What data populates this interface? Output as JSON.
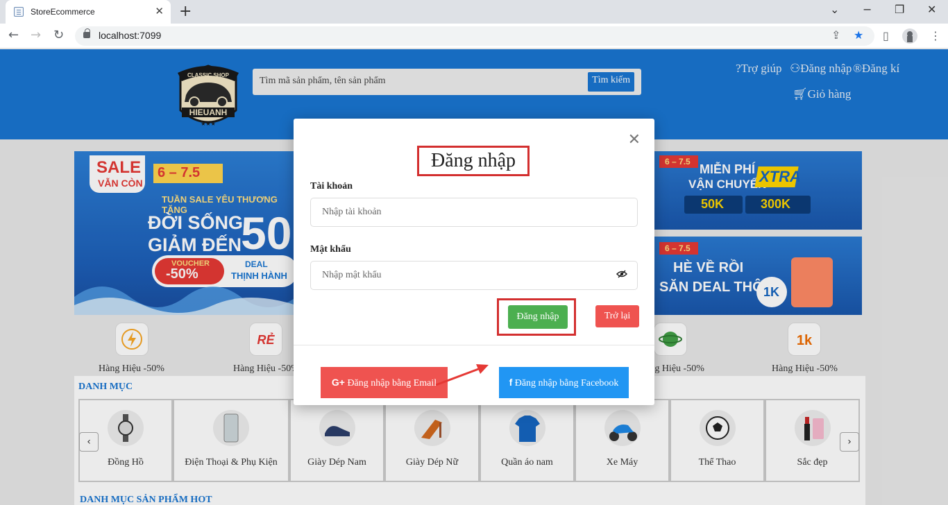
{
  "browser": {
    "tab_title": "StoreEcommerce",
    "url": "localhost:7099"
  },
  "header": {
    "search_placeholder": "Tìm mã sản phẩm, tên sản phẩm",
    "search_button": "Tìm kiếm",
    "help": "Trợ giúp",
    "login": "Đăng nhập",
    "register": "Đăng kí",
    "cart": "Giỏ hàng",
    "logo": {
      "top": "CLASSIC SHOP",
      "name": "HIEUANH"
    }
  },
  "banners": {
    "left": {
      "sale": "SALE",
      "sub": "VẪN CÒN",
      "dates": "6 – 7.5",
      "line1": "TUẦN SALE YÊU THƯƠNG TẶNG",
      "line2": "ĐỜI SỐNG",
      "line3": "GIẢM ĐẾN",
      "big": "50",
      "voucher": "VOUCHER",
      "voucher_pct": "-50%",
      "deal": "DEAL",
      "deal_sub": "THỊNH HÀNH"
    },
    "right1": {
      "dates": "6 – 7.5",
      "line1": "MIỄN PHÍ",
      "line2": "VẬN CHUYỂN",
      "xtra": "XTRA",
      "v1": "50K",
      "v2": "300K"
    },
    "right2": {
      "dates": "6 – 7.5",
      "line1": "HÈ VỀ RỒI",
      "line2": "SĂN DEAL THÔI",
      "badge": "1K"
    }
  },
  "quick_links": [
    {
      "label": "Hàng Hiệu -50%",
      "icon": "lightning-icon"
    },
    {
      "label": "Hàng Hiệu -50%",
      "icon": "re-tag-icon"
    },
    {
      "label": "Hàng Hiệu -50%",
      "icon": "globe-icon"
    },
    {
      "label": "Hàng Hiệu -50%",
      "icon": "1k-icon"
    }
  ],
  "categories": {
    "title": "DANH MỤC",
    "items": [
      {
        "label": "Đồng Hồ"
      },
      {
        "label": "Điện Thoại & Phụ Kiện"
      },
      {
        "label": "Giày Dép Nam"
      },
      {
        "label": "Giày Dép Nữ"
      },
      {
        "label": "Quần áo nam"
      },
      {
        "label": "Xe Máy"
      },
      {
        "label": "Thể Thao"
      },
      {
        "label": "Sắc đẹp"
      }
    ],
    "hot_title": "DANH MỤC SẢN PHẨM HOT"
  },
  "modal": {
    "title": "Đăng nhập",
    "account_label": "Tài khoản",
    "account_placeholder": "Nhập tài khoản",
    "password_label": "Mật khẩu",
    "password_placeholder": "Nhập mật khẩu",
    "login_button": "Đăng nhập",
    "back_button": "Trở lại",
    "google_button": "Đăng nhập bằng Email",
    "facebook_button": "Đăng nhập bằng Facebook",
    "highlight_color": "#d32f2f"
  }
}
